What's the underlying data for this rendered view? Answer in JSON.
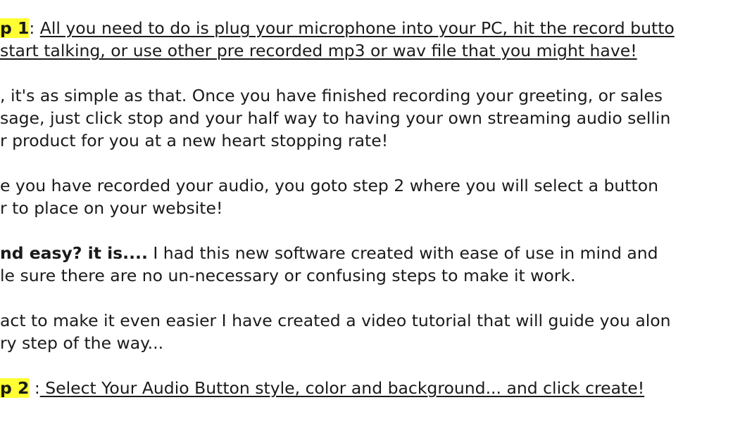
{
  "step1": {
    "label": "p 1",
    "sep": ": ",
    "line1": "All you need to do is plug your microphone into your PC, hit the record butto",
    "line2": " start talking, or use other pre recorded mp3 or wav file that you might have!"
  },
  "para1": {
    "line1": ", it's as simple as that. Once you have finished recording your greeting, or sales",
    "line2": "sage, just click stop and your half way to having your own streaming audio sellin",
    "line3": "r product for you at a new heart stopping rate!"
  },
  "para2": {
    "line1": "e you have recorded your audio, you goto step 2 where you will select a button",
    "line2": "r to place on your website!"
  },
  "para3": {
    "bold": "nd easy? it is....",
    "line1_rest": " I had this new software created with ease of use in mind and",
    "line2": "le sure there are no un-necessary or confusing steps to make it work."
  },
  "para4": {
    "line1": "act to make it even easier I have created a video tutorial that will guide you alon",
    "line2": "ry step of the way..."
  },
  "step2": {
    "label": "p 2",
    "sep": " :",
    "text": " Select Your Audio Button style, color and background... and click create!"
  },
  "colors": {
    "highlight": "#ffff33",
    "text": "#1a1a1a"
  }
}
